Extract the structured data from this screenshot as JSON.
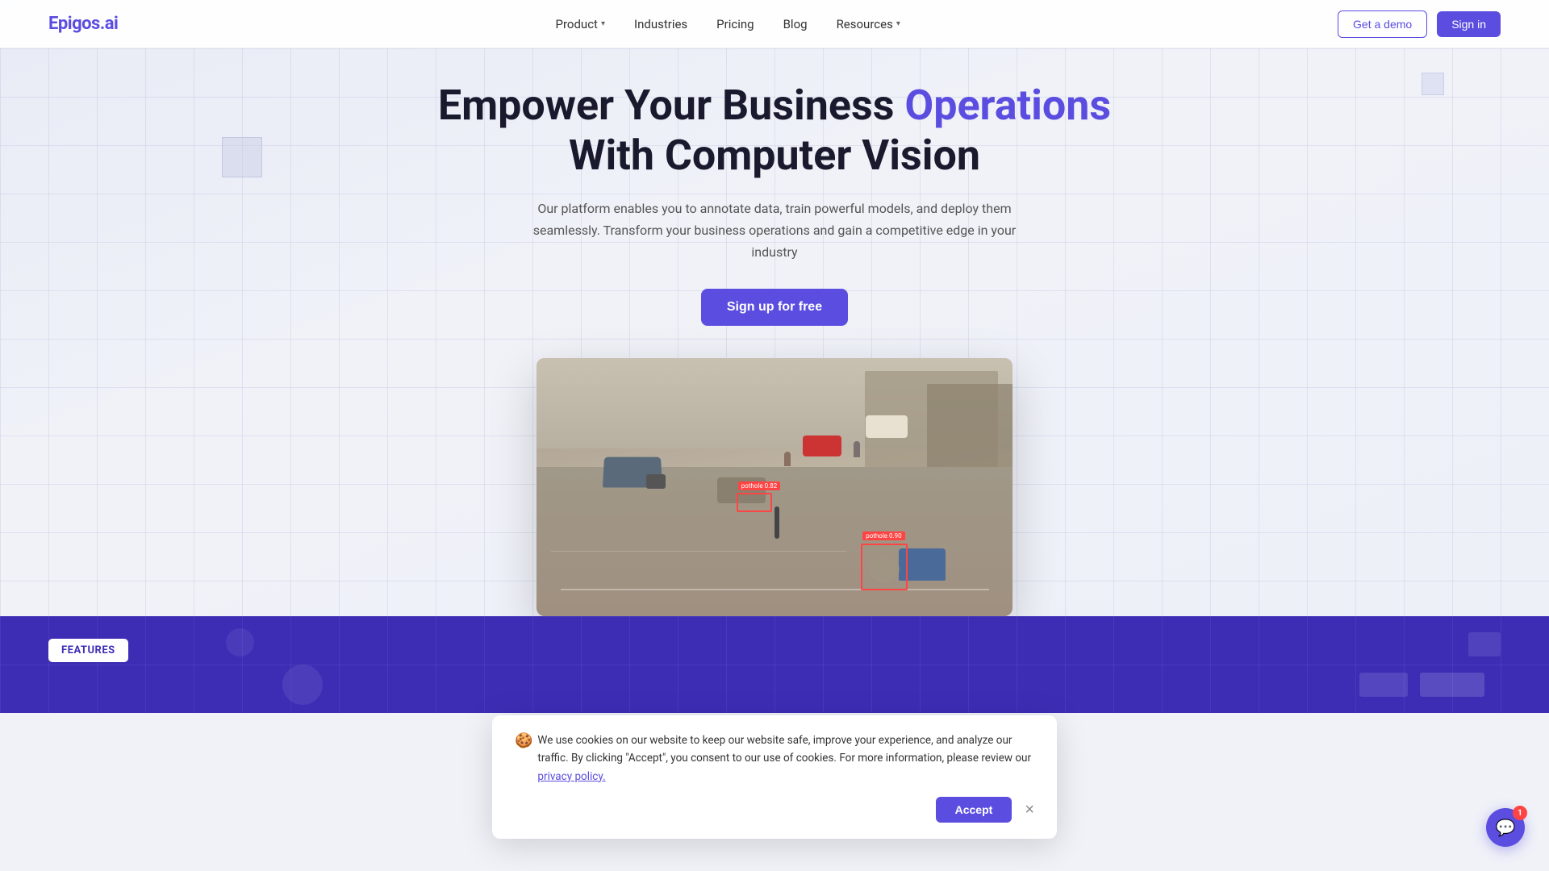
{
  "nav": {
    "logo": "Epigos.ai",
    "links": [
      {
        "label": "Product",
        "hasDropdown": true
      },
      {
        "label": "Industries",
        "hasDropdown": false
      },
      {
        "label": "Pricing",
        "hasDropdown": false
      },
      {
        "label": "Blog",
        "hasDropdown": false
      },
      {
        "label": "Resources",
        "hasDropdown": true
      }
    ],
    "demo_btn": "Get a demo",
    "signin_btn": "Sign in"
  },
  "hero": {
    "title_part1": "Empower Your Business ",
    "title_accent": "Operations",
    "title_part2": "With Computer Vision",
    "subtitle": "Our platform enables you to annotate data, train powerful models, and deploy them seamlessly. Transform your business operations and gain a competitive edge in your industry",
    "cta_btn": "Sign up for free",
    "detection_label_1": "pothole  0.82",
    "detection_label_2": "pothole  0.90"
  },
  "features": {
    "badge": "FEATURES"
  },
  "cookie": {
    "icon": "🍪",
    "text": "We use cookies on our website to keep our website safe, improve your experience, and analyze our traffic. By clicking \"Accept\", you consent to our use of cookies. For more information, please review our ",
    "link_text": "privacy policy.",
    "accept_btn": "Accept",
    "close_btn": "×"
  },
  "chat": {
    "badge_count": "1"
  },
  "colors": {
    "accent": "#5b4de0",
    "features_bg": "#3d2db5",
    "detect_red": "#ff4444"
  }
}
